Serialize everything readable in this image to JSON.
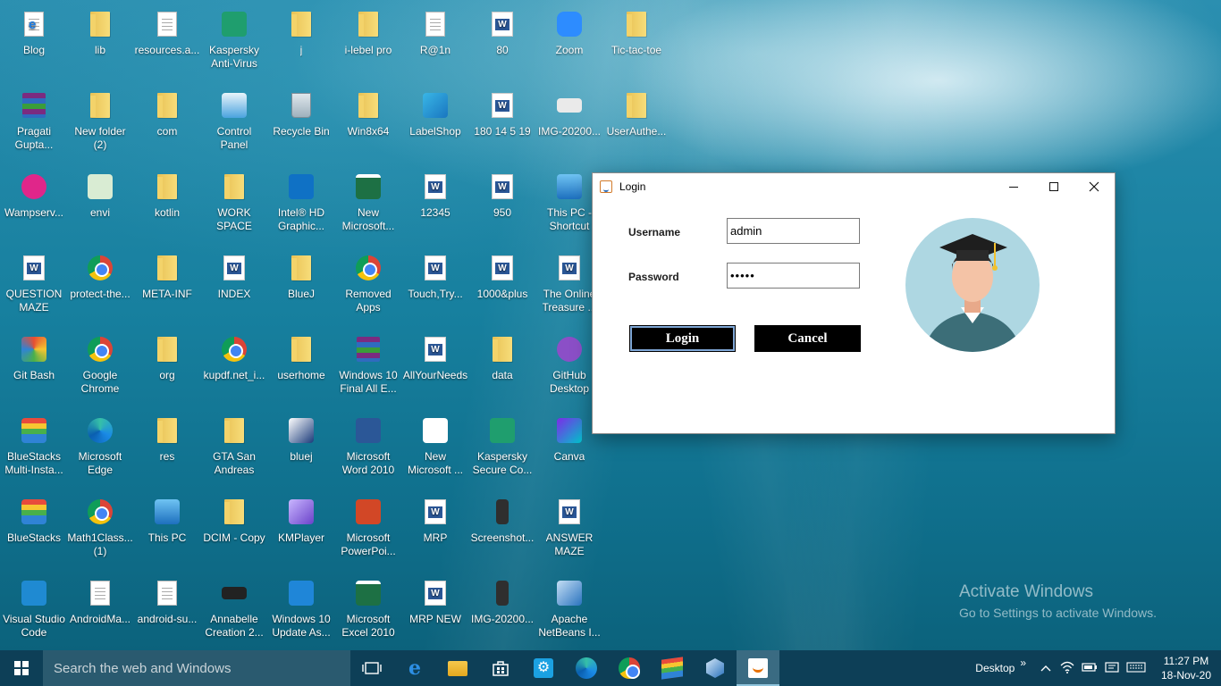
{
  "desktop": {
    "icons": [
      {
        "label": "Blog",
        "type": "file-ie"
      },
      {
        "label": "lib",
        "type": "folder"
      },
      {
        "label": "resources.a...",
        "type": "file"
      },
      {
        "label": "Kaspersky\nAnti-Virus",
        "type": "kaspersky"
      },
      {
        "label": "j",
        "type": "folder"
      },
      {
        "label": "i-lebel pro",
        "type": "folder"
      },
      {
        "label": "R@1n",
        "type": "file"
      },
      {
        "label": "80",
        "type": "word"
      },
      {
        "label": "Zoom",
        "type": "zoom"
      },
      {
        "label": "Tic-tac-toe",
        "type": "folder"
      },
      {
        "label": "Pragati\nGupta...",
        "type": "rar"
      },
      {
        "label": "New folder\n(2)",
        "type": "folder"
      },
      {
        "label": "com",
        "type": "folder"
      },
      {
        "label": "Control\nPanel",
        "type": "control-panel"
      },
      {
        "label": "Recycle Bin",
        "type": "bin"
      },
      {
        "label": "Win8x64",
        "type": "folder"
      },
      {
        "label": "LabelShop",
        "type": "labelshop"
      },
      {
        "label": "180 14 5 19",
        "type": "word"
      },
      {
        "label": "IMG-20200...",
        "type": "image"
      },
      {
        "label": "UserAuthe...",
        "type": "folder"
      },
      {
        "label": "Wampserv...",
        "type": "wamp"
      },
      {
        "label": "envi",
        "type": "envi"
      },
      {
        "label": "kotlin",
        "type": "folder"
      },
      {
        "label": "WORK SPACE",
        "type": "folder"
      },
      {
        "label": "Intel® HD\nGraphic...",
        "type": "intel"
      },
      {
        "label": "New\nMicrosoft...",
        "type": "excel"
      },
      {
        "label": "12345",
        "type": "word"
      },
      {
        "label": "950",
        "type": "word"
      },
      {
        "label": "This PC -\nShortcut",
        "type": "thispc"
      },
      {
        "label": "QUESTION\nMAZE",
        "type": "word"
      },
      {
        "label": "protect-the...",
        "type": "chrome"
      },
      {
        "label": "META-INF",
        "type": "folder"
      },
      {
        "label": "INDEX",
        "type": "word"
      },
      {
        "label": "BlueJ",
        "type": "folder"
      },
      {
        "label": "Removed\nApps",
        "type": "chrome"
      },
      {
        "label": "Touch,Try...",
        "type": "word"
      },
      {
        "label": "1000&plus",
        "type": "word"
      },
      {
        "label": "The Online\nTreasure ...",
        "type": "word"
      },
      {
        "label": "Git Bash",
        "type": "git"
      },
      {
        "label": "Google\nChrome",
        "type": "chrome"
      },
      {
        "label": "org",
        "type": "folder"
      },
      {
        "label": "kupdf.net_i...",
        "type": "chrome"
      },
      {
        "label": "userhome",
        "type": "folder"
      },
      {
        "label": "Windows 10\nFinal All E...",
        "type": "rar"
      },
      {
        "label": "AllYourNeeds",
        "type": "word"
      },
      {
        "label": "data",
        "type": "folder"
      },
      {
        "label": "GitHub\nDesktop",
        "type": "github"
      },
      {
        "label": "BlueStacks\nMulti-Insta...",
        "type": "bluestacks"
      },
      {
        "label": "Microsoft\nEdge",
        "type": "edge"
      },
      {
        "label": "res",
        "type": "folder"
      },
      {
        "label": "GTA San\nAndreas",
        "type": "folder"
      },
      {
        "label": "bluej",
        "type": "bluej"
      },
      {
        "label": "Microsoft\nWord 2010",
        "type": "word-app"
      },
      {
        "label": "New\nMicrosoft ...",
        "type": "blank"
      },
      {
        "label": "Kaspersky\nSecure Co...",
        "type": "kaspersky-secure"
      },
      {
        "label": "Canva",
        "type": "canva"
      },
      {
        "label": "BlueStacks",
        "type": "bluestacks"
      },
      {
        "label": "Math1Class...\n(1)",
        "type": "chrome"
      },
      {
        "label": "This PC",
        "type": "thispc"
      },
      {
        "label": "DCIM - Copy",
        "type": "folder"
      },
      {
        "label": "KMPlayer",
        "type": "kmplayer"
      },
      {
        "label": "Microsoft\nPowerPoi...",
        "type": "ppt"
      },
      {
        "label": "MRP",
        "type": "word"
      },
      {
        "label": "Screenshot...",
        "type": "phone"
      },
      {
        "label": "ANSWER\nMAZE",
        "type": "word"
      },
      {
        "label": "Visual Studio\nCode",
        "type": "vscode"
      },
      {
        "label": "AndroidMa...",
        "type": "file-web"
      },
      {
        "label": "android-su...",
        "type": "file"
      },
      {
        "label": "Annabelle\nCreation 2...",
        "type": "video"
      },
      {
        "label": "Windows 10\nUpdate As...",
        "type": "winupdate"
      },
      {
        "label": "Microsoft\nExcel 2010",
        "type": "excel-app"
      },
      {
        "label": "MRP NEW",
        "type": "word"
      },
      {
        "label": "IMG-20200...",
        "type": "phone"
      },
      {
        "label": "Apache\nNetBeans I...",
        "type": "netbeans"
      }
    ]
  },
  "login_window": {
    "title": "Login",
    "username_label": "Username",
    "username_value": "admin",
    "password_label": "Password",
    "password_value": "•••••",
    "login_button": "Login",
    "cancel_button": "Cancel"
  },
  "activation": {
    "line1": "Activate Windows",
    "line2": "Go to Settings to activate Windows."
  },
  "taskbar": {
    "search_placeholder": "Search the web and Windows",
    "desktop_label": "Desktop",
    "chevron": "»",
    "time": "11:27 PM",
    "date": "18-Nov-20"
  },
  "colors": {
    "taskbar": "#0d3f57",
    "search_box": "#2a5a6f",
    "button_bg": "#000000",
    "avatar_bg": "#aed7e2"
  }
}
